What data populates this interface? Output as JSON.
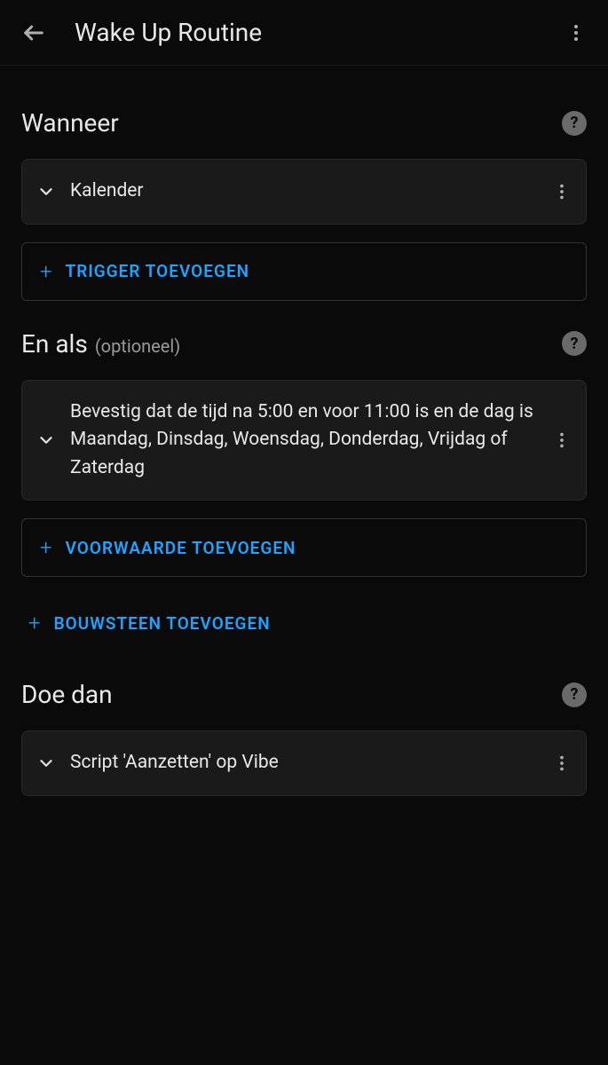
{
  "header": {
    "title": "Wake Up Routine"
  },
  "sections": {
    "when": {
      "title": "Wanneer",
      "card_label": "Kalender",
      "add_trigger": "TRIGGER TOEVOEGEN"
    },
    "and_if": {
      "title": "En als",
      "subtitle": "(optioneel)",
      "condition_text": "Bevestig dat de tijd na 5:00 en voor 11:00 is en de dag is Maandag, Dinsdag, Woensdag, Donderdag, Vrijdag of Zaterdag",
      "add_condition": "VOORWAARDE TOEVOEGEN",
      "add_block": "BOUWSTEEN TOEVOEGEN"
    },
    "then": {
      "title": "Doe dan",
      "script_label": "Script 'Aanzetten' op Vibe"
    }
  }
}
